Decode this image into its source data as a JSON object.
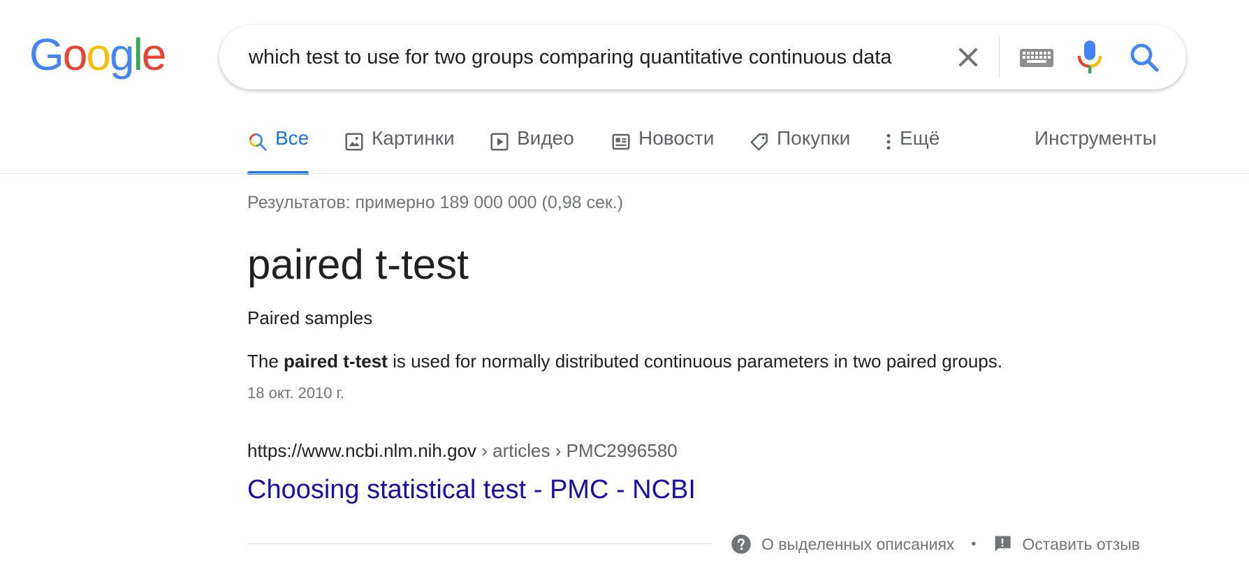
{
  "logo": {
    "letters": [
      "G",
      "o",
      "o",
      "g",
      "l",
      "e"
    ],
    "colors": [
      "#4285F4",
      "#EA4335",
      "#FBBC05",
      "#4285F4",
      "#34A853",
      "#EA4335"
    ]
  },
  "search": {
    "value": "which test to use for two groups comparing quantitative continuous data",
    "icons": [
      "close-icon",
      "keyboard-icon",
      "microphone-icon",
      "search-icon"
    ]
  },
  "tabs": [
    {
      "label": "Все",
      "icon": "search-multicolor-icon",
      "active": true
    },
    {
      "label": "Картинки",
      "icon": "image-icon",
      "active": false
    },
    {
      "label": "Видео",
      "icon": "video-icon",
      "active": false
    },
    {
      "label": "Новости",
      "icon": "news-icon",
      "active": false
    },
    {
      "label": "Покупки",
      "icon": "tag-icon",
      "active": false
    },
    {
      "label": "Ещё",
      "icon": "more-vert-icon",
      "active": false
    }
  ],
  "tools_label": "Инструменты",
  "result_stats": "Результатов: примерно 189 000 000 (0,98 сек.)",
  "featured": {
    "answer": "paired t-test",
    "subheading": "Paired samples",
    "snippet_before": "The ",
    "snippet_bold": "paired t-test",
    "snippet_after": " is used for normally distributed continuous parameters in two paired groups.",
    "date": "18 окт. 2010 г.",
    "cite_domain": "https://www.ncbi.nlm.nih.gov",
    "cite_path": " › articles › PMC2996580",
    "title": "Choosing statistical test - PMC - NCBI"
  },
  "footer": {
    "about_label": "О выделенных описаниях",
    "separator": "•",
    "feedback_label": "Оставить отзыв"
  },
  "colors": {
    "accent": "#1a73e8",
    "link": "#1a0dab",
    "muted": "#70757a"
  }
}
